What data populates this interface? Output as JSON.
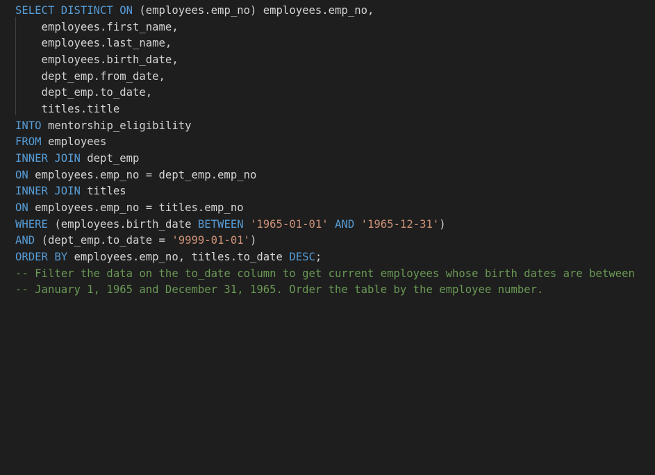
{
  "colors": {
    "background": "#1e1e1e",
    "keyword": "#569cd6",
    "string": "#ce9178",
    "comment": "#6a9955",
    "text": "#d4d4d4"
  },
  "lines": [
    {
      "tokens": [
        {
          "t": "kw",
          "v": "SELECT DISTINCT ON "
        },
        {
          "t": "tx",
          "v": "(employees.emp_no) employees.emp_no,"
        }
      ]
    },
    {
      "tokens": [
        {
          "t": "tx",
          "v": "    employees.first_name,"
        }
      ]
    },
    {
      "tokens": [
        {
          "t": "tx",
          "v": "    employees.last_name,"
        }
      ]
    },
    {
      "tokens": [
        {
          "t": "tx",
          "v": "    employees.birth_date,"
        }
      ]
    },
    {
      "tokens": [
        {
          "t": "tx",
          "v": "    dept_emp.from_date,"
        }
      ]
    },
    {
      "tokens": [
        {
          "t": "tx",
          "v": "    dept_emp.to_date,"
        }
      ]
    },
    {
      "tokens": [
        {
          "t": "tx",
          "v": "    titles.title"
        }
      ]
    },
    {
      "tokens": [
        {
          "t": "kw",
          "v": "INTO "
        },
        {
          "t": "tx",
          "v": "mentorship_eligibility"
        }
      ]
    },
    {
      "tokens": [
        {
          "t": "kw",
          "v": "FROM "
        },
        {
          "t": "tx",
          "v": "employees"
        }
      ]
    },
    {
      "tokens": [
        {
          "t": "kw",
          "v": "INNER JOIN "
        },
        {
          "t": "tx",
          "v": "dept_emp"
        }
      ]
    },
    {
      "tokens": [
        {
          "t": "kw",
          "v": "ON "
        },
        {
          "t": "tx",
          "v": "employees.emp_no = dept_emp.emp_no"
        }
      ]
    },
    {
      "tokens": [
        {
          "t": "kw",
          "v": "INNER JOIN "
        },
        {
          "t": "tx",
          "v": "titles"
        }
      ]
    },
    {
      "tokens": [
        {
          "t": "kw",
          "v": "ON "
        },
        {
          "t": "tx",
          "v": "employees.emp_no = titles.emp_no"
        }
      ]
    },
    {
      "tokens": [
        {
          "t": "kw",
          "v": "WHERE "
        },
        {
          "t": "tx",
          "v": "(employees.birth_date "
        },
        {
          "t": "kw",
          "v": "BETWEEN "
        },
        {
          "t": "str",
          "v": "'1965-01-01'"
        },
        {
          "t": "tx",
          "v": " "
        },
        {
          "t": "kw",
          "v": "AND "
        },
        {
          "t": "str",
          "v": "'1965-12-31'"
        },
        {
          "t": "tx",
          "v": ")"
        }
      ]
    },
    {
      "tokens": [
        {
          "t": "kw",
          "v": "AND "
        },
        {
          "t": "tx",
          "v": "(dept_emp.to_date = "
        },
        {
          "t": "str",
          "v": "'9999-01-01'"
        },
        {
          "t": "tx",
          "v": ")"
        }
      ]
    },
    {
      "tokens": [
        {
          "t": "kw",
          "v": "ORDER BY "
        },
        {
          "t": "tx",
          "v": "employees.emp_no, titles.to_date "
        },
        {
          "t": "kw",
          "v": "DESC"
        },
        {
          "t": "tx",
          "v": ";"
        }
      ]
    },
    {
      "tokens": [
        {
          "t": "cm",
          "v": "-- Filter the data on the to_date column to get current employees whose birth dates are between"
        }
      ]
    },
    {
      "tokens": [
        {
          "t": "cm",
          "v": "-- January 1, 1965 and December 31, 1965. Order the table by the employee number."
        }
      ]
    }
  ]
}
